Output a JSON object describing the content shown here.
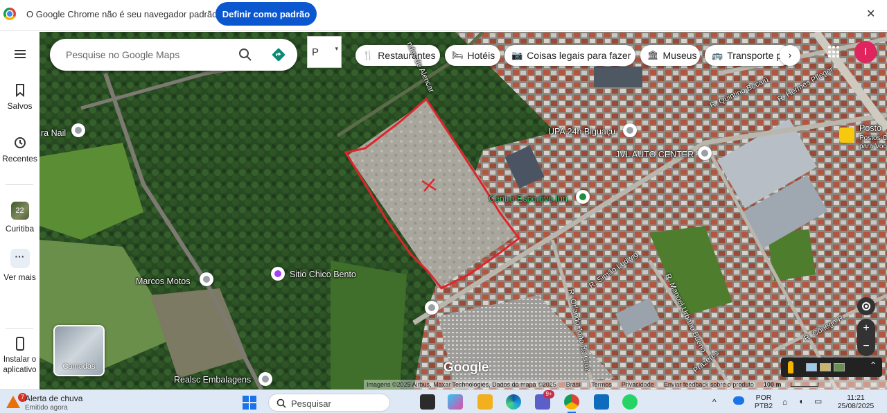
{
  "infobar": {
    "message": "O Google Chrome não é seu navegador padrão",
    "button": "Definir como padrão",
    "close": "✕"
  },
  "rail": {
    "menu_icon": "menu-icon",
    "saved": "Salvos",
    "recent": "Recentes",
    "curitiba": "Curitiba",
    "curitiba_badge": "22",
    "more": "Ver mais",
    "install": "Instalar o aplicativo"
  },
  "search": {
    "placeholder": "Pesquise no Google Maps"
  },
  "parking": {
    "label": "P"
  },
  "chips": [
    {
      "label": "Restaurantes",
      "icon": "🍴"
    },
    {
      "label": "Hotéis",
      "icon": "🛏"
    },
    {
      "label": "Coisas legais para fazer",
      "icon": "📷"
    },
    {
      "label": "Museus",
      "icon": "🏛"
    },
    {
      "label": "Transporte p",
      "icon": "🚌"
    }
  ],
  "avatar": {
    "initial": "I",
    "color": "#e0245e"
  },
  "places": {
    "upa": "UPA 24h Biguaçu",
    "jvl": "JVL AUTO CENTER",
    "centro": "Centro Esportivo Iuri",
    "sitio": "Sitio Chico Bento",
    "marcos": "Marcos Motos",
    "nail": "ra Nail",
    "realsc": "Realsc Embalagens",
    "posto": "Posto",
    "postos_sub1": "Postos C",
    "postos_sub2": "para Voc"
  },
  "streets": {
    "quintino": "R. Quintino Bocaiú",
    "pfleger": "R. Hermes Pfleger",
    "simao": "R. Simão Ludwig",
    "manoel": "R. Manoel Urbano Bueno",
    "orlando": "R. Orlando João da Cruz",
    "conego": "R. Cônego R",
    "prazeres": "Prazeres",
    "alencar": "ndes de Alencar"
  },
  "map": {
    "layers_label": "Camadas",
    "google": "Google",
    "attribution": "Imagens ©2025 Airbus, Maxar Technologies, Dados do mapa ©2025",
    "brasil": "Brasil",
    "termos": "Termos",
    "privacidade": "Privacidade",
    "feedback": "Enviar feedback sobre o produto",
    "scale": "100 m",
    "zoom_in": "+",
    "zoom_out": "−"
  },
  "taskbar": {
    "weather_badge": "7",
    "weather_title": "Alerta de chuva",
    "weather_sub": "Emitido agora",
    "search": "Pesquisar",
    "teams_badge": "9+",
    "lang1": "POR",
    "lang2": "PTB2",
    "time": "11:21",
    "date": "25/08/2025"
  },
  "colors": {
    "accent": "#0b57d0",
    "outline": "#e0242b"
  }
}
